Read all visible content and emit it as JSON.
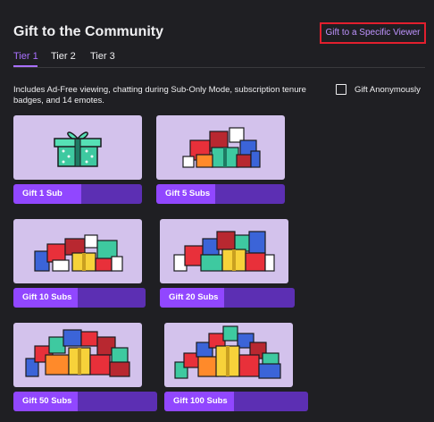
{
  "header": {
    "title": "Gift to the Community",
    "specific_viewer_link": "Gift to a Specific Viewer"
  },
  "tabs": [
    {
      "label": "Tier 1",
      "active": true
    },
    {
      "label": "Tier 2",
      "active": false
    },
    {
      "label": "Tier 3",
      "active": false
    }
  ],
  "description": "Includes Ad-Free viewing, chatting during Sub-Only Mode, subscription tenure badges, and 14 emotes.",
  "anonymous": {
    "label": "Gift Anonymously",
    "checked": false
  },
  "gift_options": [
    {
      "label": "Gift 1 Sub",
      "icon": "gift-icon"
    },
    {
      "label": "Gift 5 Subs",
      "icon": "gift-pile-icon"
    },
    {
      "label": "Gift 10 Subs",
      "icon": "gift-pile-icon"
    },
    {
      "label": "Gift 20 Subs",
      "icon": "gift-pile-icon"
    },
    {
      "label": "Gift 50 Subs",
      "icon": "gift-pile-icon"
    },
    {
      "label": "Gift 100 Subs",
      "icon": "gift-pile-icon"
    }
  ],
  "colors": {
    "background": "#1f1f23",
    "accent": "#a970ff",
    "button": "#9147ff",
    "button_dark": "#5c2fb3",
    "card": "#d3c2ec",
    "highlight_border": "#e21f2e"
  }
}
